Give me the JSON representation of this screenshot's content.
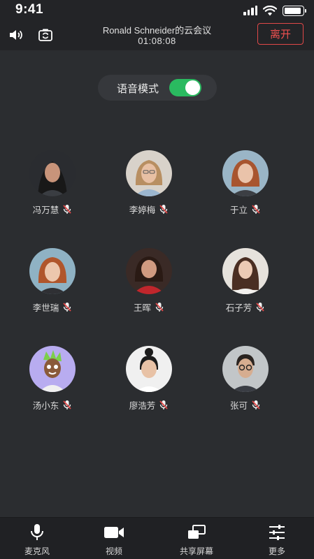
{
  "status_bar": {
    "time": "9:41",
    "battery_level": 0.9
  },
  "header": {
    "meeting_title": "Ronald Schneider的云会议",
    "timer": "01:08:08",
    "leave_label": "离开",
    "speaker_icon": "speaker-icon",
    "switch_camera_icon": "switch-camera-icon"
  },
  "voice_mode": {
    "label": "语音模式",
    "enabled": true
  },
  "participants": [
    {
      "name": "冯万慧",
      "muted": true,
      "avatar": "woman-dark-hair"
    },
    {
      "name": "李婷梅",
      "muted": true,
      "avatar": "woman-blonde-glasses"
    },
    {
      "name": "于立",
      "muted": true,
      "avatar": "woman-red-hair"
    },
    {
      "name": "李世瑞",
      "muted": true,
      "avatar": "woman-red-hair-2"
    },
    {
      "name": "王晖",
      "muted": true,
      "avatar": "woman-red-top"
    },
    {
      "name": "石子芳",
      "muted": true,
      "avatar": "woman-long-hair"
    },
    {
      "name": "汤小东",
      "muted": true,
      "avatar": "cartoon-boy"
    },
    {
      "name": "廖浩芳",
      "muted": true,
      "avatar": "woman-bun"
    },
    {
      "name": "张可",
      "muted": true,
      "avatar": "man-glasses"
    }
  ],
  "toolbar": {
    "mic_label": "麦克风",
    "video_label": "视频",
    "share_label": "共享屏幕",
    "more_label": "更多"
  },
  "colors": {
    "accent_green": "#2aba60",
    "leave_red": "#e04848",
    "muted_red": "#e04848"
  }
}
